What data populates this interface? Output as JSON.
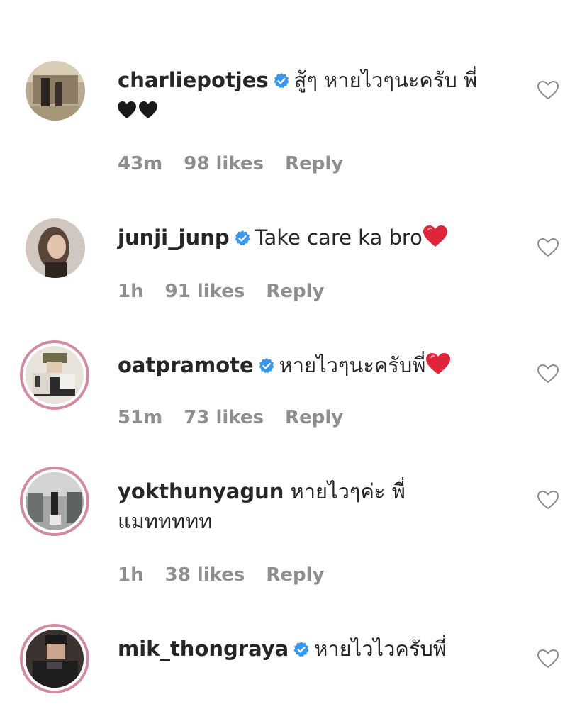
{
  "comments": [
    {
      "username": "charliepotjes",
      "verified": true,
      "text": "สู้ๆ หายไวๆนะครับ พี่",
      "emoji": "black-hearts",
      "time": "43m",
      "likes": "98 likes",
      "reply": "Reply"
    },
    {
      "username": "junji_junp",
      "verified": true,
      "text": "Take care ka bro",
      "emoji": "red-heart",
      "time": "1h",
      "likes": "91 likes",
      "reply": "Reply"
    },
    {
      "username": "oatpramote",
      "verified": true,
      "text": "หายไวๆนะครับพี่",
      "emoji": "red-heart",
      "time": "51m",
      "likes": "73 likes",
      "reply": "Reply"
    },
    {
      "username": "yokthunyagun",
      "verified": false,
      "text": "หายไวๆค่ะ พี่ แมททททท",
      "emoji": "",
      "time": "1h",
      "likes": "38 likes",
      "reply": "Reply"
    },
    {
      "username": "mik_thongraya",
      "verified": true,
      "text": "หายไวไวครับพี่",
      "emoji": "",
      "time": "",
      "likes": "",
      "reply": ""
    }
  ],
  "colors": {
    "text": "#262626",
    "meta": "#8e8e8e",
    "verified": "#3897f0",
    "story_ring": "#d28ba3",
    "heart_red": "#e0243a"
  }
}
